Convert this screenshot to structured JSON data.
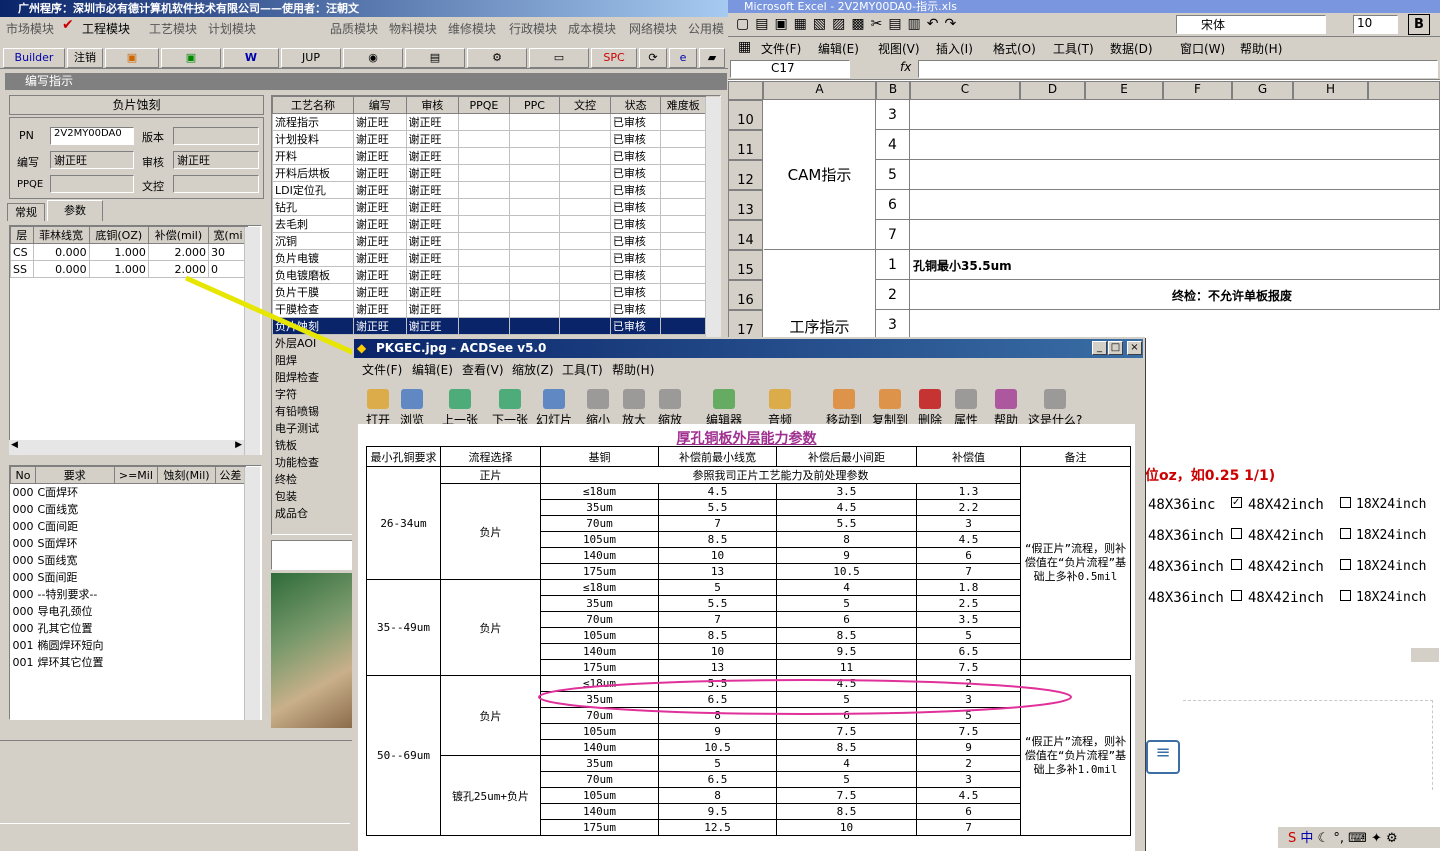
{
  "left_app": {
    "title": "广州程序：深圳市必有德计算机软件技术有限公司——使用者：汪朝文",
    "menu": [
      "市场模块",
      "工程模块",
      "工艺模块",
      "计划模块",
      "品质模块",
      "物料模块",
      "维修模块",
      "行政模块",
      "成本模块",
      "网络模块",
      "公用模"
    ],
    "toolbar": [
      "Builder",
      "注销",
      "JUP",
      "SPC"
    ],
    "panel_title": "编写指示",
    "section": "负片蚀刻",
    "fields": {
      "pn_label": "PN",
      "pn_value": "2V2MY00DA0",
      "version_label": "版本",
      "version_value": "",
      "writer_label": "编写",
      "writer_value": "谢正旺",
      "reviewer_label": "审核",
      "reviewer_value": "谢正旺",
      "ppqe_label": "PPQE",
      "ppqe_value": "",
      "wenkong_label": "文控",
      "wenkong_value": ""
    },
    "tabs": [
      "常规",
      "参数"
    ],
    "layer_table": {
      "headers": [
        "层",
        "菲林线宽",
        "底铜(OZ)",
        "补偿(mil)",
        "宽(mi"
      ],
      "rows": [
        [
          "CS",
          "0.000",
          "1.000",
          "2.000",
          "30"
        ],
        [
          "SS",
          "0.000",
          "1.000",
          "2.000",
          "0"
        ]
      ]
    },
    "req_table": {
      "headers": [
        "No",
        "要求",
        ">=Mil",
        "蚀刻(Mil)",
        "公差"
      ],
      "rows": [
        [
          "000",
          "C面焊环"
        ],
        [
          "000",
          "C面线宽"
        ],
        [
          "000",
          "C面间距"
        ],
        [
          "000",
          "S面焊环"
        ],
        [
          "000",
          "S面线宽"
        ],
        [
          "000",
          "S面间距"
        ],
        [
          "000",
          "--特别要求--"
        ],
        [
          "000",
          "导电孔颈位"
        ],
        [
          "000",
          "孔其它位置"
        ],
        [
          "001",
          "椭圆焊环短向"
        ],
        [
          "001",
          "焊环其它位置"
        ]
      ]
    },
    "process_table": {
      "headers": [
        "工艺名称",
        "编写",
        "审核",
        "PPQE",
        "PPC",
        "文控",
        "状态",
        "难度板"
      ],
      "rows": [
        [
          "流程指示",
          "谢正旺",
          "谢正旺",
          "已审核"
        ],
        [
          "计划投料",
          "谢正旺",
          "谢正旺",
          "已审核"
        ],
        [
          "开料",
          "谢正旺",
          "谢正旺",
          "已审核"
        ],
        [
          "开料后烘板",
          "谢正旺",
          "谢正旺",
          "已审核"
        ],
        [
          "LDI定位孔",
          "谢正旺",
          "谢正旺",
          "已审核"
        ],
        [
          "钻孔",
          "谢正旺",
          "谢正旺",
          "已审核"
        ],
        [
          "去毛刺",
          "谢正旺",
          "谢正旺",
          "已审核"
        ],
        [
          "沉铜",
          "谢正旺",
          "谢正旺",
          "已审核"
        ],
        [
          "负片电镀",
          "谢正旺",
          "谢正旺",
          "已审核"
        ],
        [
          "负电镀磨板",
          "谢正旺",
          "谢正旺",
          "已审核"
        ],
        [
          "负片干膜",
          "谢正旺",
          "谢正旺",
          "已审核"
        ],
        [
          "干膜检查",
          "谢正旺",
          "谢正旺",
          "已审核"
        ],
        [
          "负片蚀刻",
          "谢正旺",
          "谢正旺",
          "已审核"
        ],
        [
          "外层AOI",
          "",
          "",
          ""
        ],
        [
          "阻焊",
          "",
          "",
          ""
        ],
        [
          "阻焊检查",
          "",
          "",
          ""
        ],
        [
          "字符",
          "",
          "",
          ""
        ],
        [
          "有铅喷锡",
          "",
          "",
          ""
        ],
        [
          "电子测试",
          "",
          "",
          ""
        ],
        [
          "铣板",
          "",
          "",
          ""
        ],
        [
          "功能检查",
          "",
          "",
          ""
        ],
        [
          "终检",
          "",
          "",
          ""
        ],
        [
          "包装",
          "",
          "",
          ""
        ],
        [
          "成品仓",
          "",
          "",
          ""
        ]
      ]
    }
  },
  "excel": {
    "title": "Microsoft Excel - 2V2MY00DA0-指示.xls",
    "font": "宋体",
    "size": "10",
    "menu": [
      "文件(F)",
      "编辑(E)",
      "视图(V)",
      "插入(I)",
      "格式(O)",
      "工具(T)",
      "数据(D)",
      "窗口(W)",
      "帮助(H)"
    ],
    "namebox": "C17",
    "cols": [
      "A",
      "B",
      "C",
      "D",
      "E",
      "F",
      "G",
      "H"
    ],
    "rows": [
      "10",
      "11",
      "12",
      "13",
      "14",
      "15",
      "16",
      "17"
    ],
    "b_vals": [
      "3",
      "4",
      "5",
      "6",
      "7",
      "1",
      "2",
      "3"
    ],
    "cam": "CAM指示",
    "proc": "工序指示",
    "c15": "孔铜最小35.5um",
    "c16": "终检：不允许单板报废",
    "unit_note": "位oz，如0.25 1/1)",
    "sizes": [
      [
        "48X36inc",
        "48X42inch",
        "18X24inch"
      ],
      [
        "48X36inch",
        "48X42inch",
        "18X24inch"
      ],
      [
        "48X36inch",
        "48X42inch",
        "18X24inch"
      ],
      [
        "48X36inch",
        "48X42inch",
        "18X24inch"
      ]
    ]
  },
  "acdsee": {
    "title": "PKGEC.jpg - ACDSee v5.0",
    "menu": [
      "文件(F)",
      "编辑(E)",
      "查看(V)",
      "缩放(Z)",
      "工具(T)",
      "帮助(H)"
    ],
    "tools": [
      "打开",
      "浏览",
      "上一张",
      "下一张",
      "幻灯片",
      "缩小",
      "放大",
      "缩放",
      "编辑器",
      "音频",
      "移动到",
      "复制到",
      "删除",
      "属性",
      "帮助",
      "这是什么?"
    ],
    "sheet_title": "厚孔铜板外层能力参数",
    "headers": [
      "最小孔铜要求",
      "流程选择",
      "基铜",
      "补偿前最小线宽",
      "补偿后最小间距",
      "补偿值",
      "备注"
    ],
    "zhengpian": "正片",
    "zheng_note": "参照我司正片工艺能力及前处理参数",
    "groups": [
      {
        "range": "26-34um",
        "flow": "负片",
        "rows": [
          [
            "≤18um",
            "4.5",
            "3.5",
            "1.3"
          ],
          [
            "35um",
            "5.5",
            "4.5",
            "2.2"
          ],
          [
            "70um",
            "7",
            "5.5",
            "3"
          ],
          [
            "105um",
            "8.5",
            "8",
            "4.5"
          ],
          [
            "140um",
            "10",
            "9",
            "6"
          ],
          [
            "175um",
            "13",
            "10.5",
            "7"
          ]
        ]
      },
      {
        "range": "35--49um",
        "flow": "负片",
        "rows": [
          [
            "≤18um",
            "5",
            "4",
            "1.8"
          ],
          [
            "35um",
            "5.5",
            "5",
            "2.5"
          ],
          [
            "70um",
            "7",
            "6",
            "3.5"
          ],
          [
            "105um",
            "8.5",
            "8.5",
            "5"
          ],
          [
            "140um",
            "10",
            "9.5",
            "6.5"
          ],
          [
            "175um",
            "13",
            "11",
            "7.5"
          ]
        ]
      },
      {
        "range": "50--69um",
        "flow": "负片",
        "rows": [
          [
            "≤18um",
            "5.5",
            "4.5",
            "2"
          ],
          [
            "35um",
            "6.5",
            "5",
            "3"
          ],
          [
            "70um",
            "8",
            "6",
            "5"
          ],
          [
            "105um",
            "9",
            "7.5",
            "7.5"
          ],
          [
            "140um",
            "10.5",
            "8.5",
            "9"
          ]
        ]
      },
      {
        "range": "",
        "flow": "镀孔25um+负片",
        "rows": [
          [
            "35um",
            "5",
            "4",
            "2"
          ],
          [
            "70um",
            "6.5",
            "5",
            "3"
          ],
          [
            "105um",
            "8",
            "7.5",
            "4.5"
          ],
          [
            "140um",
            "9.5",
            "8.5",
            "6"
          ],
          [
            "175um",
            "12.5",
            "10",
            "7"
          ]
        ]
      }
    ],
    "note1": "“假正片”流程，则补偿值在“负片流程”基础上多补0.5mil",
    "note2": "“假正片”流程，则补偿值在“负片流程”基础上多补1.0mil"
  }
}
